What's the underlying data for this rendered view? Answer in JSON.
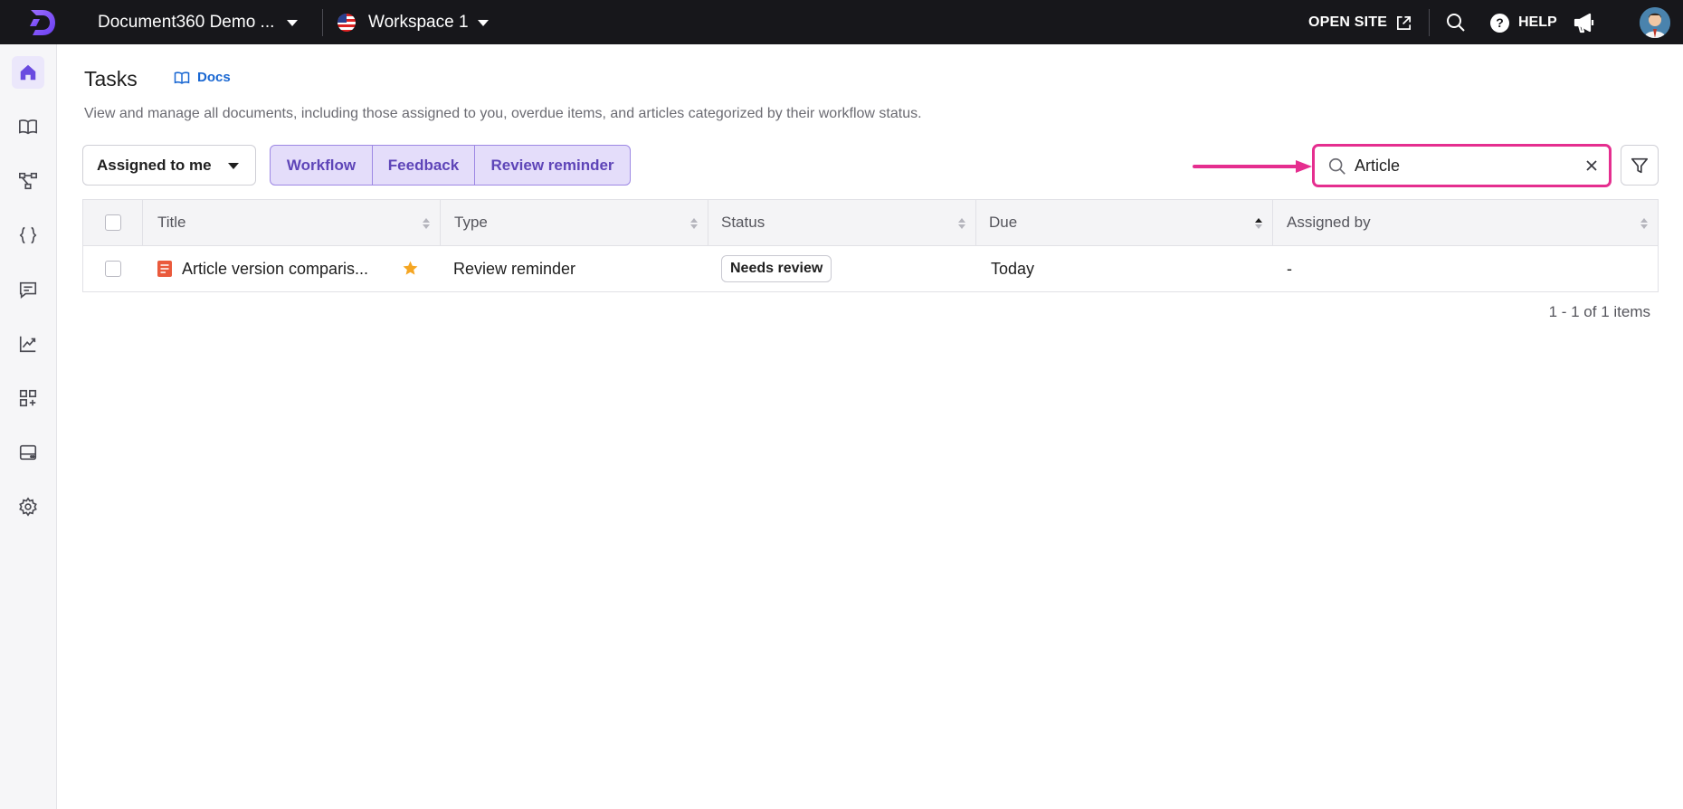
{
  "topbar": {
    "project_name": "Document360 Demo ...",
    "workspace_name": "Workspace 1",
    "open_site_label": "OPEN SITE",
    "help_label": "HELP",
    "help_glyph": "?"
  },
  "sidebar": {
    "items": [
      {
        "icon": "home-icon",
        "active": true
      },
      {
        "icon": "book-icon",
        "active": false
      },
      {
        "icon": "workflow-icon",
        "active": false
      },
      {
        "icon": "braces-icon",
        "active": false
      },
      {
        "icon": "comment-icon",
        "active": false
      },
      {
        "icon": "analytics-icon",
        "active": false
      },
      {
        "icon": "apps-add-icon",
        "active": false
      },
      {
        "icon": "drive-icon",
        "active": false
      },
      {
        "icon": "settings-icon",
        "active": false
      }
    ]
  },
  "page": {
    "title": "Tasks",
    "docs_link": "Docs",
    "description": "View and manage all documents, including those assigned to you, overdue items, and articles categorized by their workflow status."
  },
  "filters": {
    "assigned_dropdown": "Assigned to me",
    "tabs": [
      "Workflow",
      "Feedback",
      "Review reminder"
    ]
  },
  "search": {
    "value": "Article",
    "placeholder": ""
  },
  "table": {
    "columns": [
      "Title",
      "Type",
      "Status",
      "Due",
      "Assigned by"
    ],
    "rows": [
      {
        "title": "Article version comparis...",
        "type": "Review reminder",
        "status": "Needs review",
        "due": "Today",
        "assigned_by": "-"
      }
    ]
  },
  "pagination": {
    "summary": "1 - 1 of 1 items"
  },
  "colors": {
    "topbar_bg": "#17171b",
    "accent_purple": "#5e45b8",
    "highlight_pink": "#e52e8f",
    "link_blue": "#1967d2",
    "star": "#f5a623",
    "doc_icon": "#ea5a3c"
  }
}
